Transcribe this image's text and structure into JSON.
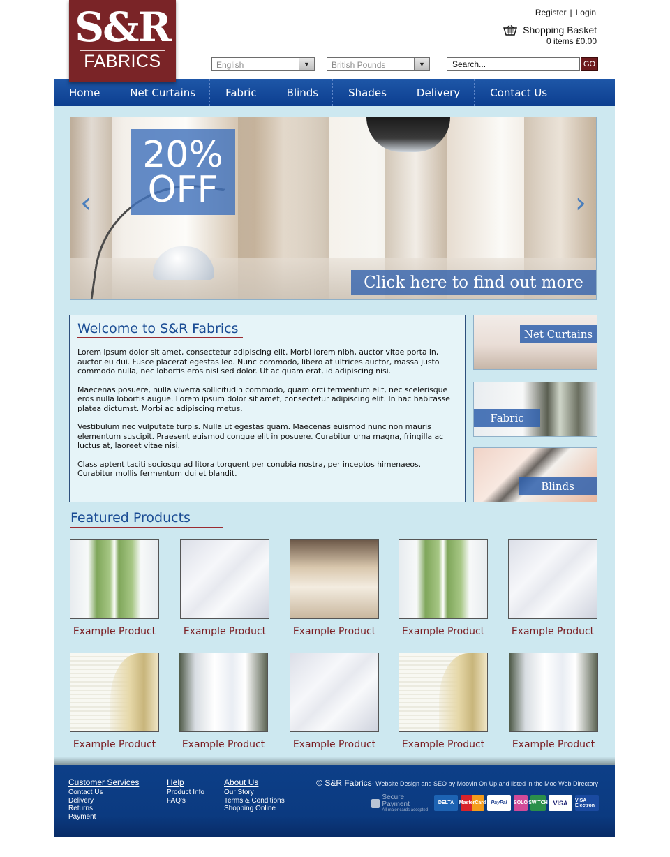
{
  "logo": {
    "line1": "S&R",
    "line2": "FABRICS"
  },
  "header": {
    "register": "Register",
    "separator": "|",
    "login": "Login",
    "basket_label": "Shopping Basket",
    "basket_summary": "0 items £0.00",
    "language_value": "English",
    "currency_value": "British Pounds",
    "search_value": "Search...",
    "go_label": "GO"
  },
  "nav": [
    "Home",
    "Net Curtains",
    "Fabric",
    "Blinds",
    "Shades",
    "Delivery",
    "Contact Us"
  ],
  "banner": {
    "promo_line1": "20%",
    "promo_line2": "OFF",
    "cta": "Click here to find out more",
    "prev_icon": "‹",
    "next_icon": "›"
  },
  "welcome": {
    "title": "Welcome to S&R Fabrics",
    "paragraphs": [
      "Lorem ipsum dolor sit amet, consectetur adipiscing elit. Morbi lorem nibh, auctor vitae porta in, auctor eu dui. Fusce placerat egestas leo. Nunc commodo, libero at ultrices auctor, massa justo commodo nulla, nec lobortis eros nisl sed dolor. Ut ac quam erat, id adipiscing nisi.",
      "Maecenas posuere, nulla viverra sollicitudin commodo, quam orci fermentum elit, nec scelerisque eros nulla lobortis augue. Lorem ipsum dolor sit amet, consectetur adipiscing elit. In hac habitasse platea dictumst. Morbi ac adipiscing metus.",
      "Vestibulum nec vulputate turpis. Nulla ut egestas quam. Maecenas euismod nunc non mauris elementum suscipit. Praesent euismod congue elit in posuere. Curabitur urna magna, fringilla ac luctus at, laoreet vitae nisi.",
      "Class aptent taciti sociosqu ad litora torquent per conubia nostra, per inceptos himenaeos. Curabitur mollis fermentum dui et blandit."
    ]
  },
  "side_categories": [
    "Net Curtains",
    "Fabric",
    "Blinds"
  ],
  "featured": {
    "title": "Featured Products",
    "products": [
      "Example Product",
      "Example Product",
      "Example Product",
      "Example Product",
      "Example Product",
      "Example Product",
      "Example Product",
      "Example Product",
      "Example Product",
      "Example Product"
    ]
  },
  "footer": {
    "customer_services": {
      "title": "Customer Services",
      "links": [
        "Contact Us",
        "Delivery",
        "Returns",
        "Payment"
      ]
    },
    "help": {
      "title": "Help",
      "links": [
        "Product Info",
        "FAQ's"
      ]
    },
    "about": {
      "title": "About Us",
      "links": [
        "Our Story",
        "Terms & Conditions",
        "Shopping Online"
      ]
    },
    "copyright": "© S&R Fabrics",
    "credit": "- Website Design and SEO by Moovin On Up and listed in the Moo Web Directory",
    "secure_title": "Secure Payment",
    "secure_sub": "All major cards accepted",
    "cards": [
      "DELTA",
      "MasterCard",
      "PayPal",
      "SOLO",
      "SWITCH",
      "VISA",
      "VISA Electron"
    ]
  },
  "colors": {
    "brand": "#7a2427",
    "nav_blue": "#1e57a8",
    "page_bg": "#cde8f0",
    "product_text": "#7a1e23",
    "heading_blue": "#1a4c94"
  }
}
